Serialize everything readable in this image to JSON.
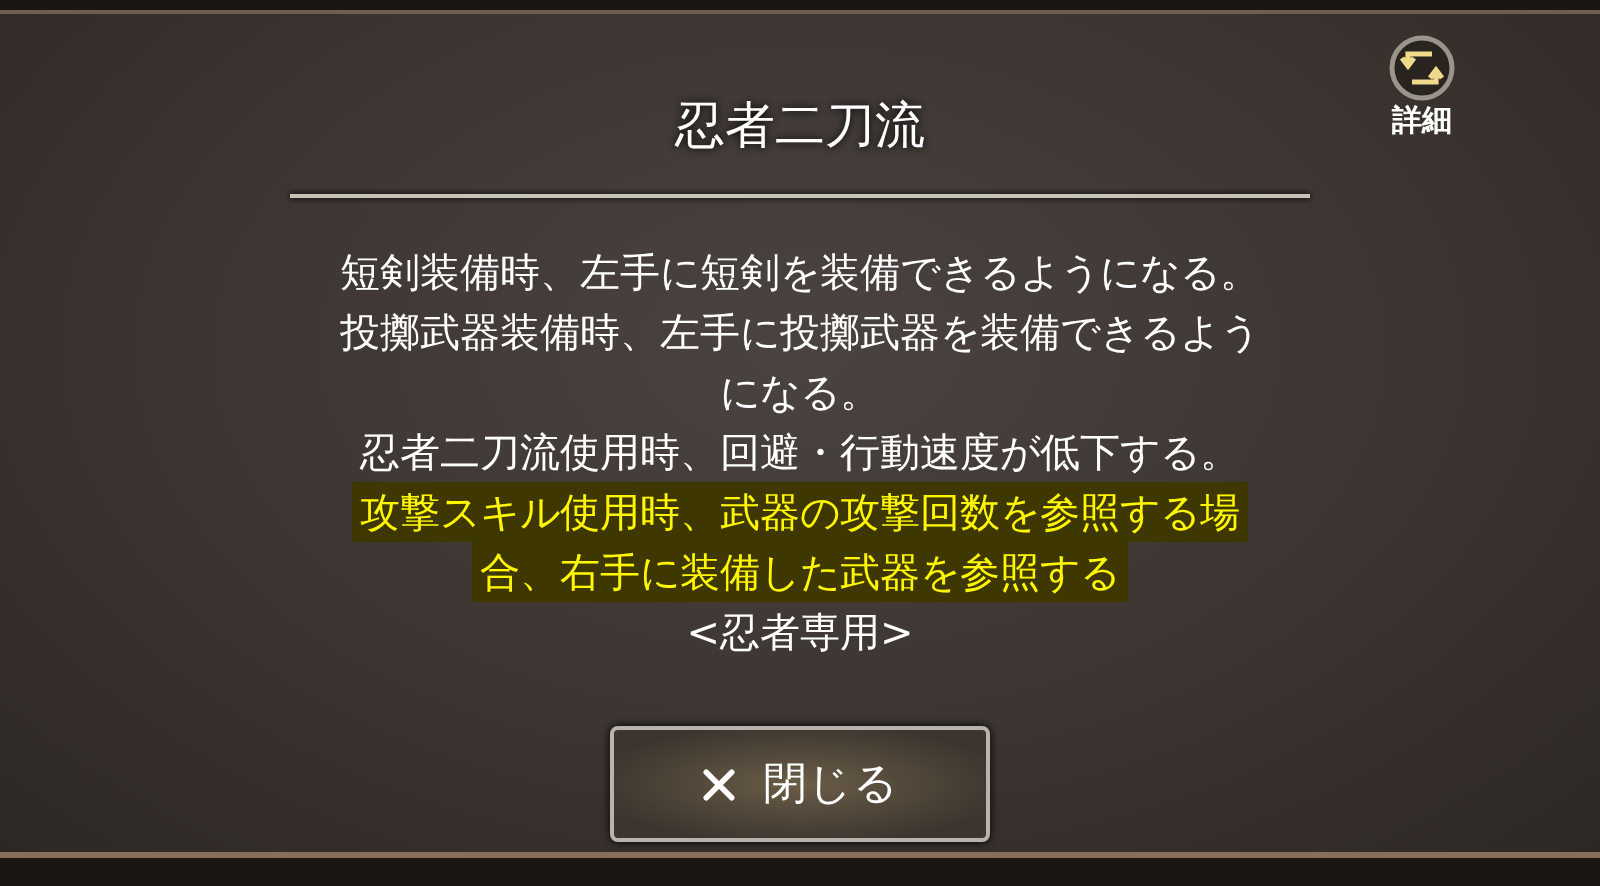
{
  "title": "忍者二刀流",
  "detail_button": {
    "label": "詳細"
  },
  "description": [
    {
      "text": "短剣装備時、左手に短剣を装備できるようになる。",
      "highlighted": false
    },
    {
      "text": "投擲武器装備時、左手に投擲武器を装備できるよう",
      "highlighted": false
    },
    {
      "text": "になる。",
      "highlighted": false
    },
    {
      "text": "忍者二刀流使用時、回避・行動速度が低下する。",
      "highlighted": false
    },
    {
      "text": "攻撃スキル使用時、武器の攻撃回数を参照する場",
      "highlighted": true
    },
    {
      "text": "合、右手に装備した武器を参照する",
      "highlighted": true
    },
    {
      "text": "<忍者専用>",
      "highlighted": false
    }
  ],
  "close_button": {
    "label": "閉じる"
  }
}
